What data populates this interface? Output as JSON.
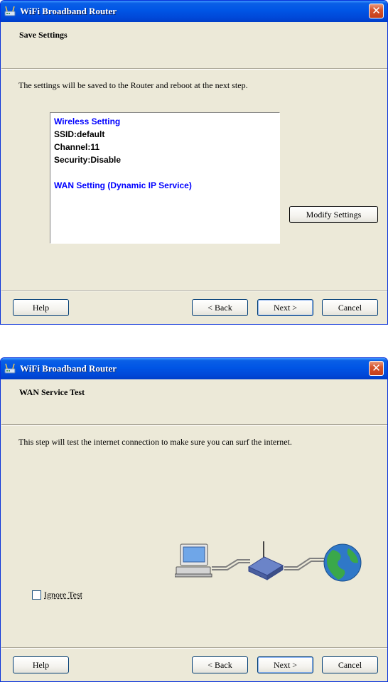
{
  "dialogs": [
    {
      "title": "WiFi Broadband Router",
      "close_glyph": "✕",
      "header_title": "Save Settings",
      "body_text": "The settings will be saved to the Router and reboot at the next step.",
      "summary": {
        "wireless_heading": "Wireless Setting",
        "ssid": "SSID:default",
        "channel": "Channel:11",
        "security": "Security:Disable",
        "wan_heading": "WAN Setting  (Dynamic IP Service)"
      },
      "modify_label": "Modify Settings",
      "buttons": {
        "help": "Help",
        "back": "< Back",
        "next": "Next >",
        "cancel": "Cancel"
      }
    },
    {
      "title": "WiFi Broadband Router",
      "close_glyph": "✕",
      "header_title": "WAN Service Test",
      "body_text": "This step will test the internet connection to make sure you can surf the internet.",
      "ignore_test_label": "Ignore Test",
      "ignore_test_checked": false,
      "illustration_icons": [
        "computer-icon",
        "router-icon",
        "globe-icon"
      ],
      "buttons": {
        "help": "Help",
        "back": "< Back",
        "next": "Next >",
        "cancel": "Cancel"
      }
    }
  ],
  "colors": {
    "titlebar": "#0055e5",
    "window_bg": "#ece9d8",
    "summary_heading": "#0000ff",
    "close_button": "#d8552e"
  }
}
